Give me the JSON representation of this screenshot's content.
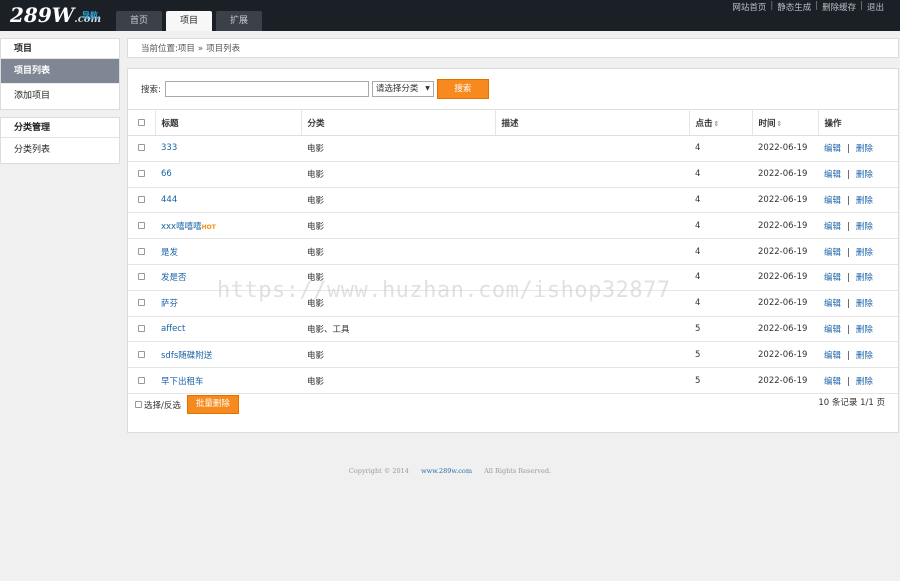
{
  "header": {
    "logo_main": "289W",
    "logo_domain": ".com",
    "logo_sub": "导航",
    "nav": [
      {
        "label": "首页",
        "active": false
      },
      {
        "label": "项目",
        "active": true
      },
      {
        "label": "扩展",
        "active": false
      }
    ],
    "links": [
      "网站首页",
      "静态生成",
      "删除缓存",
      "退出"
    ],
    "link_sep": "|"
  },
  "sidebar": {
    "groups": [
      {
        "title": "项目",
        "items": [
          {
            "label": "项目列表",
            "active": true
          },
          {
            "label": "添加项目",
            "active": false
          }
        ]
      },
      {
        "title": "分类管理",
        "items": [
          {
            "label": "分类列表",
            "active": false
          }
        ]
      }
    ]
  },
  "breadcrumb": {
    "prefix": "当前位置:",
    "items": [
      "项目",
      "项目列表"
    ],
    "sep": "»"
  },
  "search": {
    "label": "搜索:",
    "value": "",
    "select_value": "请选择分类",
    "button": "搜索"
  },
  "table": {
    "headers": {
      "title": "标题",
      "category": "分类",
      "desc": "描述",
      "clicks": "点击",
      "time": "时间",
      "ops": "操作"
    },
    "sort_mark": "⇕",
    "edit_label": "编辑",
    "delete_label": "删除",
    "op_sep": "|",
    "rows": [
      {
        "title": "333",
        "hot": "",
        "category": "电影",
        "desc": "",
        "clicks": "4",
        "time": "2022-06-19"
      },
      {
        "title": "66",
        "hot": "",
        "category": "电影",
        "desc": "",
        "clicks": "4",
        "time": "2022-06-19"
      },
      {
        "title": "444",
        "hot": "",
        "category": "电影",
        "desc": "",
        "clicks": "4",
        "time": "2022-06-19"
      },
      {
        "title": "xxx嘻嘻嘻",
        "hot": "HOT",
        "category": "电影",
        "desc": "",
        "clicks": "4",
        "time": "2022-06-19"
      },
      {
        "title": "是发",
        "hot": "",
        "category": "电影",
        "desc": "",
        "clicks": "4",
        "time": "2022-06-19"
      },
      {
        "title": "发是否",
        "hot": "",
        "category": "电影",
        "desc": "",
        "clicks": "4",
        "time": "2022-06-19"
      },
      {
        "title": "萨芬",
        "hot": "",
        "category": "电影",
        "desc": "",
        "clicks": "4",
        "time": "2022-06-19"
      },
      {
        "title": "affect",
        "hot": "",
        "category": "电影、工具",
        "desc": "",
        "clicks": "5",
        "time": "2022-06-19"
      },
      {
        "title": "sdfs随碟附送",
        "hot": "",
        "category": "电影",
        "desc": "",
        "clicks": "5",
        "time": "2022-06-19"
      },
      {
        "title": "早下出租车",
        "hot": "",
        "category": "电影",
        "desc": "",
        "clicks": "5",
        "time": "2022-06-19"
      }
    ]
  },
  "footer_bar": {
    "select_all": "选择/反选",
    "batch_delete": "批量删除",
    "pager": "10 条记录 1/1 页"
  },
  "copyright": {
    "text": "Copyright © 2014",
    "site": "www.289w.com",
    "rights": "All Rights Reserved."
  },
  "watermark": "https://www.huzhan.com/ishop32877"
}
